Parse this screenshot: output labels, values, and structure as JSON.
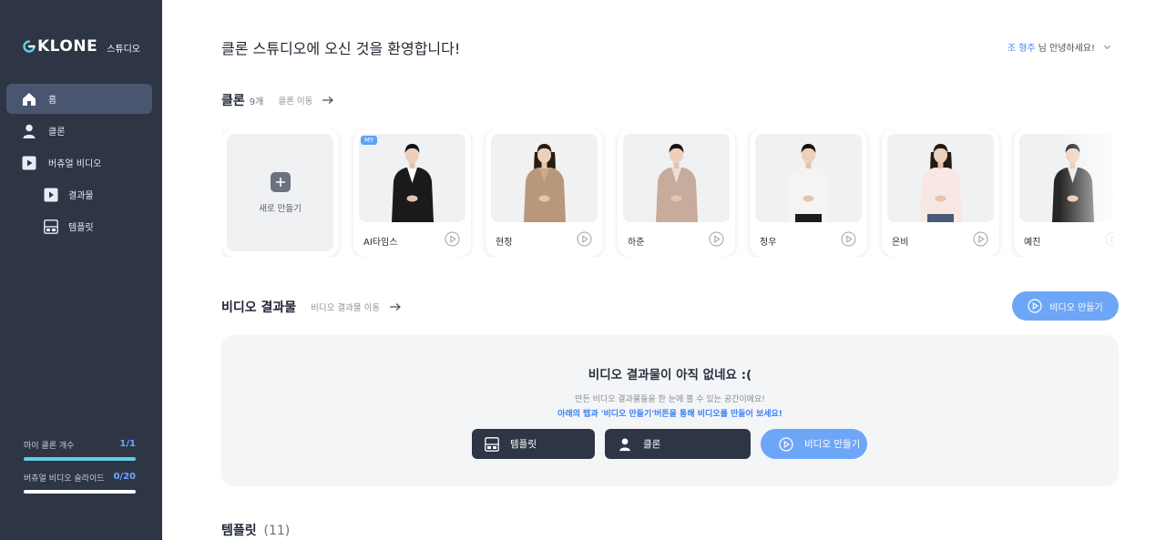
{
  "brand": {
    "logo_text": "KLONE",
    "sub": "스튜디오"
  },
  "sidebar": {
    "items": [
      {
        "label": "홈",
        "icon": "home-icon",
        "active": true
      },
      {
        "label": "클론",
        "icon": "user-icon"
      },
      {
        "label": "버츄얼 비디오",
        "icon": "video-play-icon"
      },
      {
        "label": "결과물",
        "icon": "result-icon",
        "sub": true
      },
      {
        "label": "템플릿",
        "icon": "template-icon",
        "sub": true
      }
    ],
    "usage": [
      {
        "label": "마이 클론 개수",
        "value": "1/1",
        "fraction": 1.0
      },
      {
        "label": "버츄얼 비디오 슬라이드",
        "value": "0/20",
        "fraction": 0.0
      }
    ]
  },
  "header": {
    "welcome": "클론 스튜디오에 오신 것을 환영합니다!",
    "user_name": "조 형주",
    "greeting": "님 안녕하세요!"
  },
  "clones": {
    "title": "클론",
    "count": "9개",
    "link": "클론 이동",
    "new_label": "새로 만들기",
    "my_badge": "MY",
    "items": [
      {
        "name": "AI타임스",
        "outfit": "#1a1a1a",
        "shirt": "#ffffff",
        "pants": "#1a1a1a",
        "hair": "#111111",
        "long_hair": false
      },
      {
        "name": "현정",
        "outfit": "#b8977a",
        "shirt": "#c9aa8e",
        "pants": "#b8977a",
        "hair": "#2a1b12",
        "long_hair": true
      },
      {
        "name": "하준",
        "outfit": "#c7ab9c",
        "shirt": "#e9e0d8",
        "pants": "#c7ab9c",
        "hair": "#1c1410",
        "long_hair": false
      },
      {
        "name": "정우",
        "outfit": "#f6f4f2",
        "shirt": "#f6f4f2",
        "pants": "#1c1c1c",
        "hair": "#16110d",
        "long_hair": false
      },
      {
        "name": "은비",
        "outfit": "#f8e8e4",
        "shirt": "#f8e8e4",
        "pants": "#4a5a78",
        "hair": "#241913",
        "long_hair": true
      },
      {
        "name": "예진",
        "outfit": "#262626",
        "shirt": "#e8e8e8",
        "pants": "#262626",
        "hair": "#1a1a1a",
        "long_hair": false
      }
    ]
  },
  "videos": {
    "title": "비디오 결과물",
    "link": "비디오 결과물 이동",
    "create_button": "비디오 만들기",
    "empty_title": "비디오 결과물이 아직 없네요 :(",
    "empty_desc": "만든 비디오 결과물들을 한 눈에 볼 수 있는 공간이에요!",
    "empty_hint": "아래의 탭과 '비디오 만들기'버튼을 통해 비디오를 만들어 보세요!",
    "actions": {
      "template": "템플릿",
      "clone": "클론",
      "create": "비디오 만들기"
    }
  },
  "templates": {
    "title": "템플릿",
    "count": "(11)"
  },
  "colors": {
    "sidebar": "#2e3545",
    "accent": "#6ea6f7",
    "link_blue": "#3b82f6",
    "progress": "#5fd0de"
  }
}
